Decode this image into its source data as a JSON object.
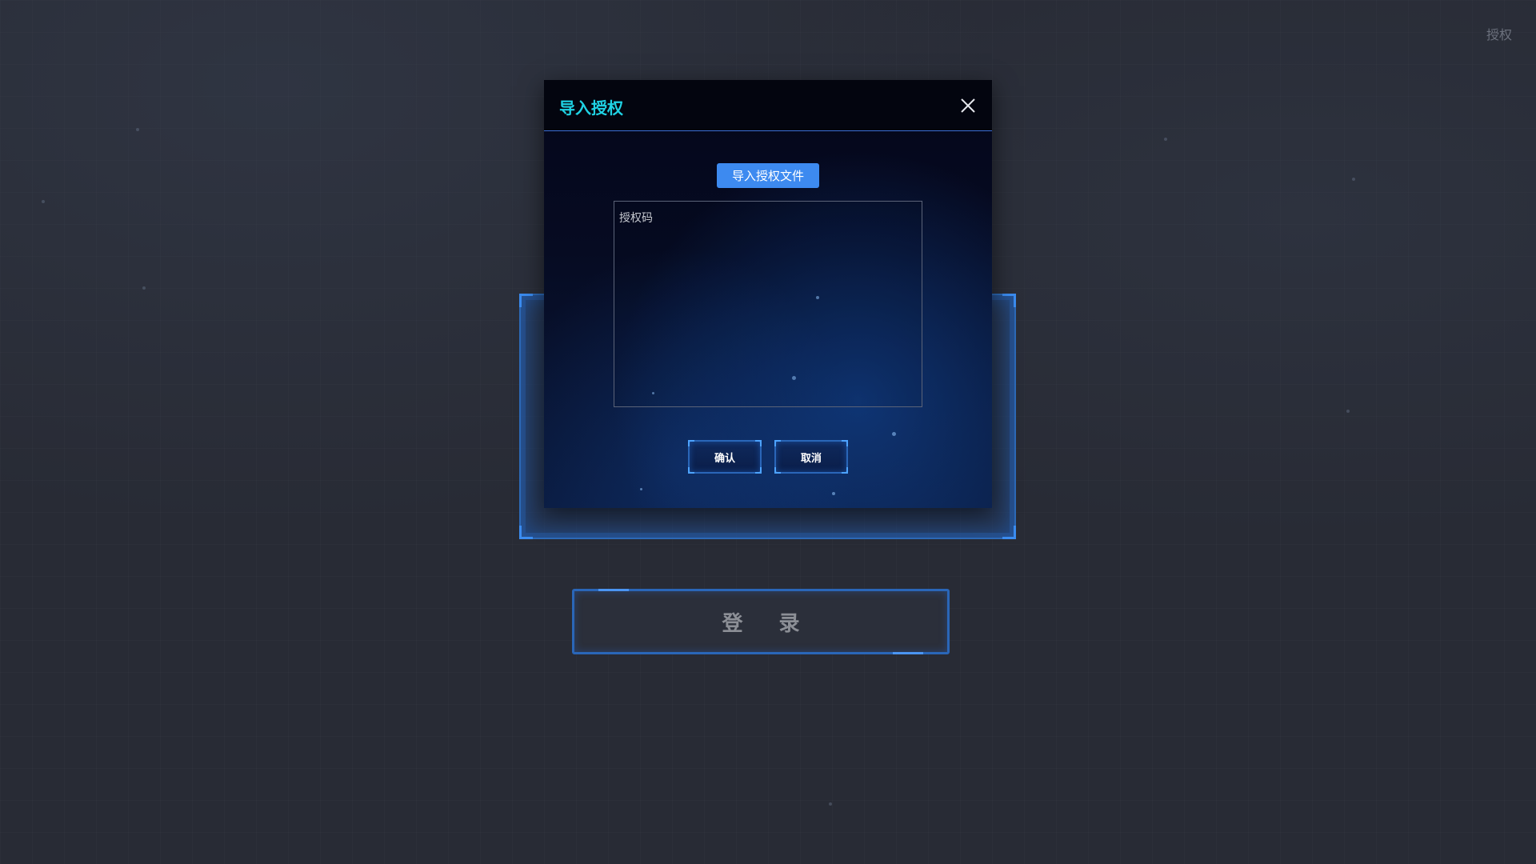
{
  "top_bar": {
    "auth_link_label": "授权"
  },
  "login": {
    "button_label": "登 录"
  },
  "modal": {
    "title": "导入授权",
    "import_file_label": "导入授权文件",
    "auth_code_placeholder": "授权码",
    "auth_code_value": "",
    "confirm_label": "确认",
    "cancel_label": "取消"
  },
  "colors": {
    "background": "#282b35",
    "title_accent": "#1fd2e4",
    "primary_button": "#3d8af0",
    "frame_border": "#2a66b8",
    "header_divider": "#3b6ed6"
  },
  "icons": {
    "close": "close-icon"
  }
}
